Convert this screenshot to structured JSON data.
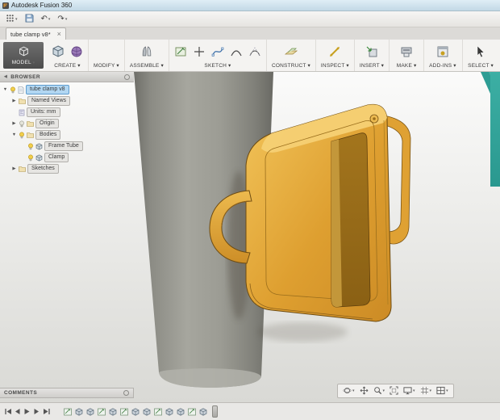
{
  "window": {
    "title": "Autodesk Fusion 360"
  },
  "qat": {
    "items": [
      {
        "name": "app-menu-button",
        "icon": "grid-menu",
        "glyph": "",
        "caret": "▾"
      },
      {
        "name": "save-button",
        "icon": "save",
        "glyph": "",
        "caret": ""
      },
      {
        "name": "undo-button",
        "icon": "",
        "glyph": "↶",
        "caret": "▾"
      },
      {
        "name": "redo-button",
        "icon": "",
        "glyph": "↷",
        "caret": "▾"
      }
    ]
  },
  "tabbar": {
    "active_tab": "tube clamp v8*",
    "close_glyph": "×"
  },
  "ribbon": {
    "model": {
      "label": "MODEL",
      "caret": "▾"
    },
    "groups": [
      {
        "label": "CREATE",
        "caret": "▾",
        "icons": [
          "box",
          "form"
        ]
      },
      {
        "label": "MODIFY",
        "caret": "▾",
        "icons": []
      },
      {
        "label": "ASSEMBLE",
        "caret": "▾",
        "icons": [
          "joint"
        ]
      },
      {
        "label": "SKETCH",
        "caret": "▾",
        "icons": [
          "sketch",
          "point",
          "spline",
          "arc",
          "conic"
        ]
      },
      {
        "label": "CONSTRUCT",
        "caret": "▾",
        "icons": [
          "plane"
        ]
      },
      {
        "label": "INSPECT",
        "caret": "▾",
        "icons": [
          "measure"
        ]
      },
      {
        "label": "INSERT",
        "caret": "▾",
        "icons": [
          "insert"
        ]
      },
      {
        "label": "MAKE",
        "caret": "▾",
        "icons": [
          "make"
        ]
      },
      {
        "label": "ADD-INS",
        "caret": "▾",
        "icons": [
          "addins"
        ]
      },
      {
        "label": "SELECT",
        "caret": "▾",
        "icons": [
          "select"
        ]
      }
    ]
  },
  "browser": {
    "header": "BROWSER",
    "items": [
      {
        "label": "tube clamp v8",
        "level": 0,
        "expander": "▼",
        "icons": [
          "bulb",
          "doc"
        ],
        "selected": true
      },
      {
        "label": "Named Views",
        "level": 1,
        "expander": "▶",
        "icons": [
          "folder"
        ],
        "selected": false
      },
      {
        "label": "Units: mm",
        "level": 1,
        "expander": "",
        "icons": [
          "units"
        ],
        "selected": false
      },
      {
        "label": "Origin",
        "level": 1,
        "expander": "▶",
        "icons": [
          "bulb-off",
          "folder"
        ],
        "selected": false
      },
      {
        "label": "Bodies",
        "level": 1,
        "expander": "▼",
        "icons": [
          "bulb",
          "folder"
        ],
        "selected": false
      },
      {
        "label": "Frame Tube",
        "level": 2,
        "expander": "",
        "icons": [
          "bulb",
          "body"
        ],
        "selected": false
      },
      {
        "label": "Clamp",
        "level": 2,
        "expander": "",
        "icons": [
          "bulb",
          "body"
        ],
        "selected": false
      },
      {
        "label": "Sketches",
        "level": 1,
        "expander": "▶",
        "icons": [
          "folder"
        ],
        "selected": false
      }
    ]
  },
  "comments": {
    "header": "COMMENTS"
  },
  "nav_toolbar": {
    "items": [
      {
        "name": "orbit",
        "caret": true
      },
      {
        "name": "pan",
        "caret": false
      },
      {
        "name": "zoom",
        "caret": true
      },
      {
        "name": "fit",
        "caret": false
      },
      {
        "name": "display-settings",
        "caret": true
      },
      {
        "name": "grid-settings",
        "caret": true
      },
      {
        "name": "viewports",
        "caret": true
      }
    ]
  },
  "timeline": {
    "playback": [
      "go-to-start",
      "step-back",
      "play",
      "step-forward",
      "go-to-end"
    ],
    "features": [
      "sketch",
      "feature",
      "feature",
      "sketch",
      "feature",
      "sketch",
      "feature",
      "feature",
      "sketch",
      "feature",
      "feature",
      "sketch",
      "feature"
    ]
  },
  "scene": {
    "bodies": [
      "Frame Tube",
      "Clamp"
    ],
    "clamp_color": "#e2a535",
    "tube_color": "#93938b",
    "background_top": "#fbfbfa",
    "background_bottom": "#d9d9d5",
    "corner_artifact_color": "#2d9d94"
  }
}
